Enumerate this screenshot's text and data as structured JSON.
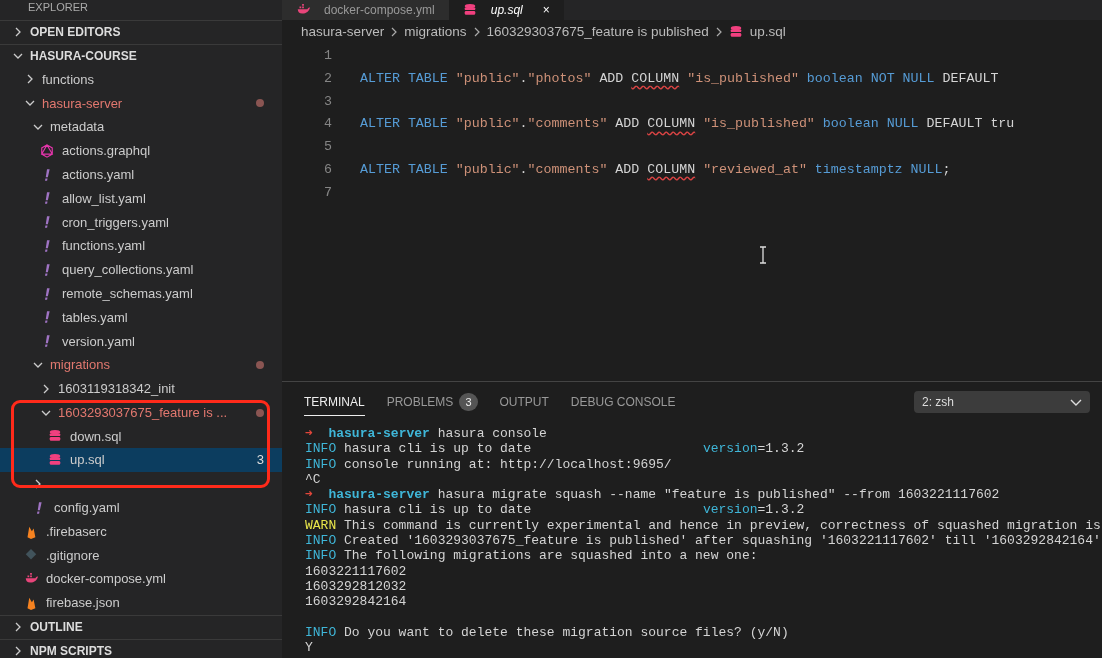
{
  "sidebar": {
    "title": "EXPLORER",
    "sections": [
      {
        "label": "OPEN EDITORS",
        "expanded": false
      },
      {
        "label": "HASURA-COURSE",
        "expanded": true,
        "items": [
          {
            "kind": "folder",
            "label": "functions",
            "expanded": false,
            "modified": false,
            "selected": false
          },
          {
            "kind": "folder",
            "label": "hasura-server",
            "expanded": true,
            "modified": true,
            "selected": false,
            "children": [
              {
                "kind": "folder",
                "label": "metadata",
                "expanded": true,
                "modified": false,
                "selected": false,
                "children": [
                  {
                    "kind": "graphql",
                    "label": "actions.graphql",
                    "modified": false,
                    "selected": false
                  },
                  {
                    "kind": "yaml",
                    "label": "actions.yaml",
                    "modified": false,
                    "selected": false
                  },
                  {
                    "kind": "yaml",
                    "label": "allow_list.yaml",
                    "modified": false,
                    "selected": false
                  },
                  {
                    "kind": "yaml",
                    "label": "cron_triggers.yaml",
                    "modified": false,
                    "selected": false
                  },
                  {
                    "kind": "yaml",
                    "label": "functions.yaml",
                    "modified": false,
                    "selected": false
                  },
                  {
                    "kind": "yaml",
                    "label": "query_collections.yaml",
                    "modified": false,
                    "selected": false
                  },
                  {
                    "kind": "yaml",
                    "label": "remote_schemas.yaml",
                    "modified": false,
                    "selected": false
                  },
                  {
                    "kind": "yaml",
                    "label": "tables.yaml",
                    "modified": false,
                    "selected": false
                  },
                  {
                    "kind": "yaml",
                    "label": "version.yaml",
                    "modified": false,
                    "selected": false
                  }
                ]
              },
              {
                "kind": "folder",
                "label": "migrations",
                "expanded": true,
                "modified": true,
                "selected": false,
                "children": [
                  {
                    "kind": "folder",
                    "label": "1603119318342_init",
                    "expanded": false,
                    "modified": false,
                    "selected": false
                  },
                  {
                    "kind": "folder",
                    "label": "1603293037675_feature is ...",
                    "expanded": true,
                    "modified": true,
                    "selected": false,
                    "children": [
                      {
                        "kind": "sql",
                        "label": "down.sql",
                        "modified": false,
                        "selected": false
                      },
                      {
                        "kind": "sql",
                        "label": "up.sql",
                        "modified": false,
                        "selected": true,
                        "problems": "3"
                      }
                    ]
                  }
                ]
              },
              {
                "kind": "folder",
                "expanded": false,
                "modified": false,
                "selected": false
              },
              {
                "kind": "yaml",
                "label": "config.yaml",
                "modified": false,
                "selected": false
              }
            ]
          },
          {
            "kind": "firebase",
            "label": ".firebaserc",
            "modified": false,
            "selected": false
          },
          {
            "kind": "git",
            "label": ".gitignore",
            "modified": false,
            "selected": false
          },
          {
            "kind": "docker",
            "label": "docker-compose.yml",
            "modified": false,
            "selected": false
          },
          {
            "kind": "firebase",
            "label": "firebase.json",
            "modified": false,
            "selected": false
          }
        ]
      },
      {
        "label": "OUTLINE",
        "expanded": false
      },
      {
        "label": "NPM SCRIPTS",
        "expanded": false
      }
    ]
  },
  "annotation": {
    "color": "#ff2a1a"
  },
  "tabs": [
    {
      "kind": "docker",
      "label": "docker-compose.yml",
      "selected": false
    },
    {
      "kind": "sql",
      "label": "up.sql",
      "selected": true,
      "close": "×"
    }
  ],
  "breadcrumb": [
    {
      "label": "hasura-server"
    },
    {
      "label": "migrations"
    },
    {
      "label": "1603293037675_feature is published"
    },
    {
      "label": "up.sql",
      "kind": "sql"
    }
  ],
  "code": [
    {
      "number": "1"
    },
    {
      "number": "2",
      "tokens": [
        {
          "kind": "keyword",
          "text": "ALTER TABLE"
        },
        {
          "kind": "string",
          "text": "\"public\""
        },
        {
          "kind": "plain",
          "text": ".",
          "joined": true
        },
        {
          "kind": "string",
          "text": "\"photos\"",
          "joined": true
        },
        {
          "kind": "plain",
          "text": "ADD"
        },
        {
          "kind": "squiggle",
          "text": "COLUMN"
        },
        {
          "kind": "string",
          "text": "\"is_published\""
        },
        {
          "kind": "keyword",
          "text": "boolean NOT NULL"
        },
        {
          "kind": "plain",
          "text": "DEFAULT"
        }
      ]
    },
    {
      "number": "3"
    },
    {
      "number": "4",
      "tokens": [
        {
          "kind": "keyword",
          "text": "ALTER TABLE"
        },
        {
          "kind": "string",
          "text": "\"public\""
        },
        {
          "kind": "plain",
          "text": ".",
          "joined": true
        },
        {
          "kind": "string",
          "text": "\"comments\"",
          "joined": true
        },
        {
          "kind": "plain",
          "text": "ADD"
        },
        {
          "kind": "squiggle",
          "text": "COLUMN"
        },
        {
          "kind": "string",
          "text": "\"is_published\""
        },
        {
          "kind": "keyword",
          "text": "boolean NULL"
        },
        {
          "kind": "plain",
          "text": "DEFAULT tru"
        }
      ]
    },
    {
      "number": "5"
    },
    {
      "number": "6",
      "tokens": [
        {
          "kind": "keyword",
          "text": "ALTER TABLE"
        },
        {
          "kind": "string",
          "text": "\"public\""
        },
        {
          "kind": "plain",
          "text": ".",
          "joined": true
        },
        {
          "kind": "string",
          "text": "\"comments\"",
          "joined": true
        },
        {
          "kind": "plain",
          "text": "ADD"
        },
        {
          "kind": "squiggle",
          "text": "COLUMN"
        },
        {
          "kind": "string",
          "text": "\"reviewed_at\""
        },
        {
          "kind": "keyword",
          "text": "timestamptz NULL"
        },
        {
          "kind": "plain",
          "text": ";",
          "joined": true
        }
      ]
    },
    {
      "number": "7"
    }
  ],
  "panel": {
    "tabs": [
      {
        "label": "TERMINAL",
        "selected": true
      },
      {
        "label": "PROBLEMS",
        "selected": false,
        "count": "3"
      },
      {
        "label": "OUTPUT",
        "selected": false
      },
      {
        "label": "DEBUG CONSOLE",
        "selected": false
      }
    ],
    "terminal_select": "2: zsh",
    "lines": [
      {
        "tokens": [
          {
            "kind": "arrow",
            "text": "➜"
          },
          {
            "kind": "dir",
            "text": "hasura-server"
          },
          {
            "kind": "plain",
            "text": "hasura console"
          }
        ]
      },
      {
        "tokens": [
          {
            "kind": "info",
            "text": "INFO"
          },
          {
            "kind": "plain",
            "text": "hasura cli is up to date                      "
          },
          {
            "kind": "info",
            "text": "version",
            "joined": true
          },
          {
            "kind": "plain",
            "text": "=1.3.2",
            "joined": true
          }
        ]
      },
      {
        "tokens": [
          {
            "kind": "info",
            "text": "INFO"
          },
          {
            "kind": "plain",
            "text": "console running at: http://localhost:9695/"
          }
        ]
      },
      {
        "tokens": [
          {
            "kind": "plain",
            "text": "^C"
          }
        ]
      },
      {
        "tokens": [
          {
            "kind": "arrow",
            "text": "➜"
          },
          {
            "kind": "dir",
            "text": "hasura-server"
          },
          {
            "kind": "plain",
            "text": "hasura migrate squash --name \"feature is published\" --from 1603221117602"
          }
        ]
      },
      {
        "tokens": [
          {
            "kind": "info",
            "text": "INFO"
          },
          {
            "kind": "plain",
            "text": "hasura cli is up to date                      "
          },
          {
            "kind": "info",
            "text": "version",
            "joined": true
          },
          {
            "kind": "plain",
            "text": "=1.3.2",
            "joined": true
          }
        ]
      },
      {
        "tokens": [
          {
            "kind": "warn",
            "text": "WARN"
          },
          {
            "kind": "plain",
            "text": "This command is currently experimental and hence in preview, correctness of squashed migration is"
          }
        ]
      },
      {
        "tokens": [
          {
            "kind": "info",
            "text": "INFO"
          },
          {
            "kind": "plain",
            "text": "Created '1603293037675_feature is published' after squashing '1603221117602' till '1603292842164'"
          }
        ]
      },
      {
        "tokens": [
          {
            "kind": "info",
            "text": "INFO"
          },
          {
            "kind": "plain",
            "text": "The following migrations are squashed into a new one:"
          }
        ]
      },
      {
        "tokens": [
          {
            "kind": "plain",
            "text": "1603221117602"
          }
        ]
      },
      {
        "tokens": [
          {
            "kind": "plain",
            "text": "1603292812032"
          }
        ]
      },
      {
        "tokens": [
          {
            "kind": "plain",
            "text": "1603292842164"
          }
        ]
      },
      {
        "kind": "blank"
      },
      {
        "tokens": [
          {
            "kind": "info",
            "text": "INFO"
          },
          {
            "kind": "plain",
            "text": "Do you want to delete these migration source files? (y/N)"
          }
        ]
      },
      {
        "tokens": [
          {
            "kind": "plain",
            "text": "Y"
          }
        ]
      }
    ]
  }
}
